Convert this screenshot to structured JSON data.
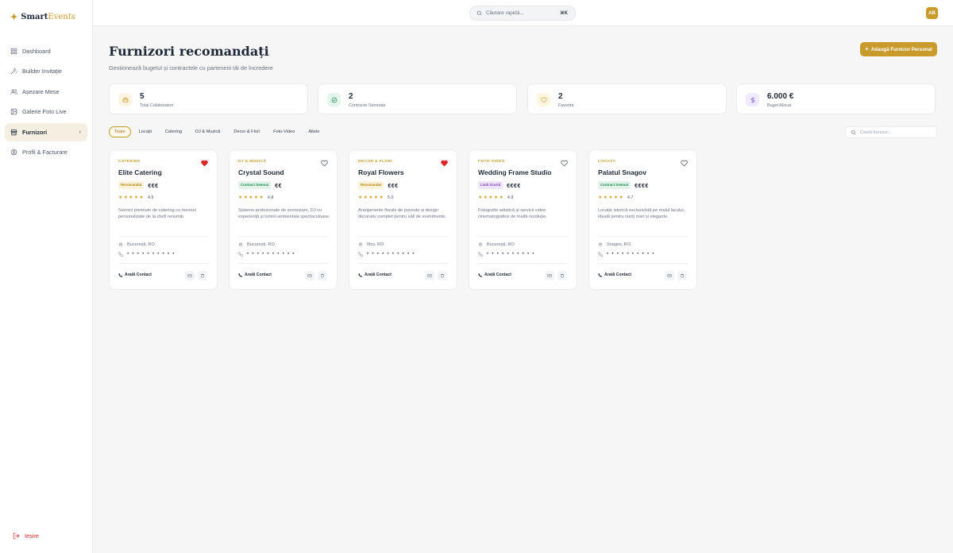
{
  "brand": {
    "part1": "Smart",
    "part2": "Events"
  },
  "sidebar": {
    "items": [
      {
        "label": "Dashboard",
        "icon": "dashboard-icon"
      },
      {
        "label": "Builder Invitație",
        "icon": "wand-icon"
      },
      {
        "label": "Așezare Mese",
        "icon": "users-icon"
      },
      {
        "label": "Galerie Foto Live",
        "icon": "image-icon"
      },
      {
        "label": "Furnizori",
        "icon": "store-icon",
        "active": true
      },
      {
        "label": "Profil & Facturare",
        "icon": "profile-icon"
      }
    ],
    "logout": "Ieșire"
  },
  "topbar": {
    "search_placeholder": "Căutare rapidă...",
    "shortcut": "⌘K",
    "avatar": "AB"
  },
  "header": {
    "title": "Furnizori recomandați",
    "subtitle": "Gestionează bugetul și contractele cu partenerii tăi de încredere",
    "add_button": "Adaugă Furnizor Personal"
  },
  "stats": [
    {
      "value": "5",
      "label": "Total Colaboratori",
      "icon": "briefcase-icon",
      "color": "#c99a2c",
      "bg": "#fbf4e3"
    },
    {
      "value": "2",
      "label": "Contracte Semnate",
      "icon": "check-circle-icon",
      "color": "#1f8a54",
      "bg": "#e4f5ec"
    },
    {
      "value": "2",
      "label": "Favorite",
      "icon": "heart-icon",
      "color": "#d4a437",
      "bg": "#fdf6e3"
    },
    {
      "value": "6.000 €",
      "label": "Buget Alocat",
      "icon": "dollar-icon",
      "color": "#7c5cd6",
      "bg": "#efeafc"
    }
  ],
  "filters": [
    "Toate",
    "Locații",
    "Catering",
    "DJ & Muzică",
    "Decor & Flori",
    "Foto-Video",
    "Altele"
  ],
  "provider_search_placeholder": "Caută furnizor...",
  "colors": {
    "accent": "#c99a2c",
    "favorite": "#dc2626"
  },
  "vendors": [
    {
      "category": "CATERING",
      "name": "Elite Catering",
      "badge": "Recomandat",
      "badge_type": "rec",
      "price": "€€€",
      "rating": "4.9",
      "description": "Servicii premium de catering cu meniuri personalizate de la chefi renumiți.",
      "location": "București, RO",
      "phone": "• • • • • • • • • •",
      "favorite": true,
      "contact": "Arată Contact"
    },
    {
      "category": "DJ & MUZICĂ",
      "name": "Crystal Sound",
      "badge": "Contract Semnat",
      "badge_type": "con",
      "price": "€€",
      "rating": "4.8",
      "description": "Sisteme profesionale de sonorizare, DJ cu experiență și lumini ambientale spectaculoase.",
      "location": "București, RO",
      "phone": "• • • • • • • • • •",
      "favorite": false,
      "contact": "Arată Contact"
    },
    {
      "category": "DECOR & FLORI",
      "name": "Royal Flowers",
      "badge": "Recomandat",
      "badge_type": "rec",
      "price": "€€€",
      "rating": "5.0",
      "description": "Aranjamente florale de poveste și design decorativ complet pentru săli de evenimente.",
      "location": "Ilfov, RO",
      "phone": "• • • • • • • • • •",
      "favorite": true,
      "contact": "Arată Contact"
    },
    {
      "category": "FOTO-VIDEO",
      "name": "Wedding Frame Studio",
      "badge": "Listă Scurtă",
      "badge_type": "list",
      "price": "€€€€",
      "rating": "4.9",
      "description": "Fotografie artistică și servicii video cinematografice de înaltă rezoluție.",
      "location": "București, RO",
      "phone": "• • • • • • • • • •",
      "favorite": false,
      "contact": "Arată Contact"
    },
    {
      "category": "LOCAȚII",
      "name": "Palatul Snagov",
      "badge": "Contract Semnat",
      "badge_type": "con",
      "price": "€€€€",
      "rating": "4.7",
      "description": "Locație istorică exclusivistă pe malul lacului, ideală pentru nunți mari și elegante.",
      "location": "Snagov, RO",
      "phone": "• • • • • • • • • •",
      "favorite": false,
      "contact": "Arată Contact"
    }
  ]
}
